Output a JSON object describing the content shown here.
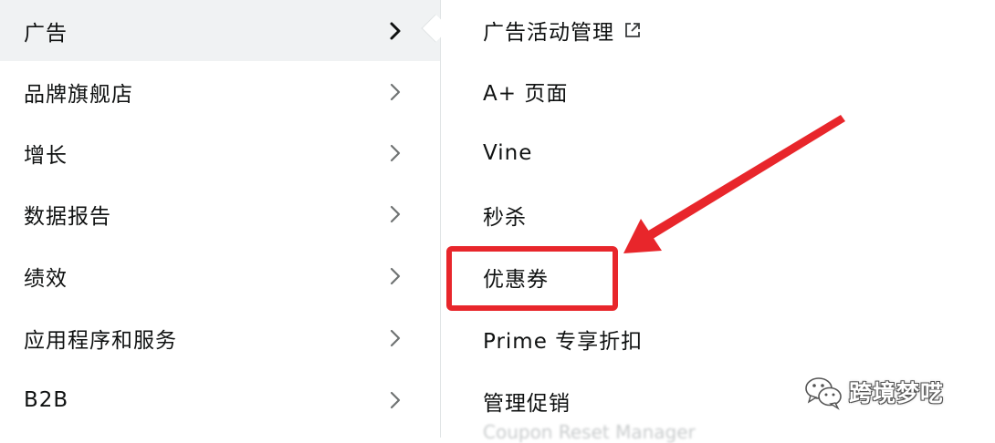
{
  "left_menu": {
    "items": [
      {
        "label": "广告",
        "active": true
      },
      {
        "label": "品牌旗舰店",
        "active": false
      },
      {
        "label": "增长",
        "active": false
      },
      {
        "label": "数据报告",
        "active": false
      },
      {
        "label": "绩效",
        "active": false
      },
      {
        "label": "应用程序和服务",
        "active": false
      },
      {
        "label": "B2B",
        "active": false
      }
    ]
  },
  "sub_menu": {
    "items": [
      {
        "label": "广告活动管理",
        "icon": "external-link-icon"
      },
      {
        "label": "A+ 页面"
      },
      {
        "label": "Vine"
      },
      {
        "label": "秒杀"
      },
      {
        "label": "优惠券",
        "highlighted": true
      },
      {
        "label": "Prime 专享折扣"
      },
      {
        "label": "管理促销"
      }
    ],
    "partial_next_item": "Coupon Reset Manager"
  },
  "annotation": {
    "color": "#e8262b"
  },
  "watermark": {
    "icon": "wechat-icon",
    "text": "跨境梦呓"
  },
  "colors": {
    "active_row_bg": "#f0f2f3",
    "text": "#0f1111",
    "divider": "#dfe3e4"
  }
}
